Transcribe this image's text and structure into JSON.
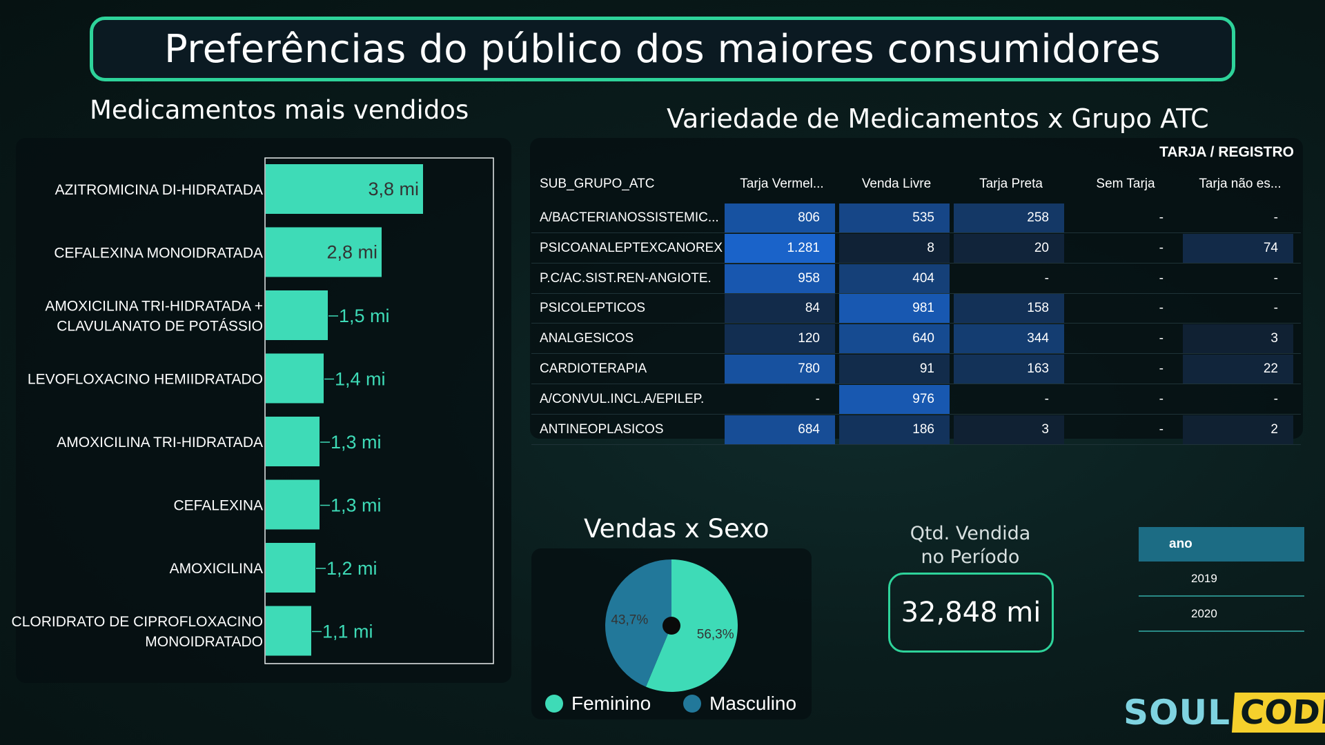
{
  "title": "Preferências do público dos maiores consumidores",
  "colors": {
    "accent": "#2ed39a",
    "bar": "#3edbb7",
    "feminino": "#3edbb7",
    "masculino": "#22789a",
    "table_highlight": "#1a63c9"
  },
  "chart_data": [
    {
      "type": "bar",
      "orientation": "horizontal",
      "title": "Medicamentos mais vendidos",
      "categories": [
        [
          "AZITROMICINA DI-HIDRATADA"
        ],
        [
          "CEFALEXINA MONOIDRATADA"
        ],
        [
          "AMOXICILINA TRI-HIDRATADA +",
          "CLAVULANATO DE POTÁSSIO"
        ],
        [
          "LEVOFLOXACINO HEMIIDRATADO"
        ],
        [
          "AMOXICILINA TRI-HIDRATADA"
        ],
        [
          "CEFALEXINA"
        ],
        [
          "AMOXICILINA"
        ],
        [
          "CLORIDRATO DE CIPROFLOXACINO",
          "MONOIDRATADO"
        ]
      ],
      "values": [
        3.8,
        2.8,
        1.5,
        1.4,
        1.3,
        1.3,
        1.2,
        1.1
      ],
      "value_labels": [
        "3,8 mi",
        "2,8 mi",
        "1,5 mi",
        "1,4 mi",
        "1,3 mi",
        "1,3 mi",
        "1,2 mi",
        "1,1 mi"
      ],
      "xlim": [
        0,
        5.5
      ]
    },
    {
      "type": "pie",
      "title": "Vendas x Sexo",
      "series": [
        {
          "name": "Feminino",
          "value": 56.3,
          "label": "56,3%"
        },
        {
          "name": "Masculino",
          "value": 43.7,
          "label": "43,7%"
        }
      ],
      "legend": "bottom"
    },
    {
      "type": "table",
      "title": "Variedade de Medicamentos x  Grupo ATC",
      "group_header": "TARJA / REGISTRO",
      "columns": [
        "SUB_GRUPO_ATC",
        "Tarja Vermel...",
        "Venda Livre",
        "Tarja Preta",
        "Sem Tarja",
        "Tarja não es..."
      ],
      "rows": [
        {
          "label": "A/BACTERIANOSSISTEMIC...",
          "values": [
            806,
            535,
            258,
            null,
            null
          ],
          "display": [
            "806",
            "535",
            "258",
            "-",
            "-"
          ]
        },
        {
          "label": "PSICOANALEPTEXCANOREX",
          "values": [
            1281,
            8,
            20,
            null,
            74
          ],
          "display": [
            "1.281",
            "8",
            "20",
            "-",
            "74"
          ]
        },
        {
          "label": "P.C/AC.SIST.REN-ANGIOTE.",
          "values": [
            958,
            404,
            null,
            null,
            null
          ],
          "display": [
            "958",
            "404",
            "-",
            "-",
            "-"
          ]
        },
        {
          "label": "PSICOLEPTICOS",
          "values": [
            84,
            981,
            158,
            null,
            null
          ],
          "display": [
            "84",
            "981",
            "158",
            "-",
            "-"
          ]
        },
        {
          "label": "ANALGESICOS",
          "values": [
            120,
            640,
            344,
            null,
            3
          ],
          "display": [
            "120",
            "640",
            "344",
            "-",
            "3"
          ]
        },
        {
          "label": "CARDIOTERAPIA",
          "values": [
            780,
            91,
            163,
            null,
            22
          ],
          "display": [
            "780",
            "91",
            "163",
            "-",
            "22"
          ]
        },
        {
          "label": "A/CONVUL.INCL.A/EPILEP.",
          "values": [
            null,
            976,
            null,
            null,
            null
          ],
          "display": [
            "-",
            "976",
            "-",
            "-",
            "-"
          ]
        },
        {
          "label": "ANTINEOPLASICOS",
          "values": [
            684,
            186,
            3,
            null,
            2
          ],
          "display": [
            "684",
            "186",
            "3",
            "-",
            "2"
          ]
        }
      ]
    }
  ],
  "kpi": {
    "label_line1": "Qtd. Vendida",
    "label_line2": "no Período",
    "value": "32,848 mi"
  },
  "filter": {
    "header": "ano",
    "items": [
      "2019",
      "2020"
    ]
  },
  "logo": {
    "part1": "SOUL",
    "part2": "CODE"
  }
}
